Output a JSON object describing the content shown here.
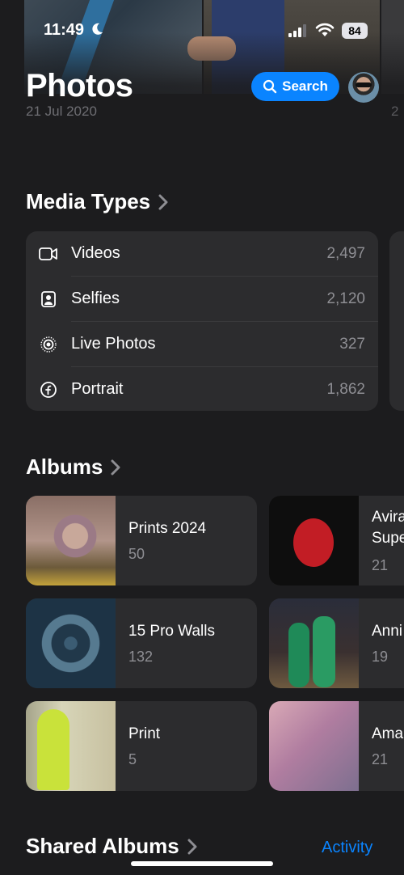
{
  "status_bar": {
    "time": "11:49",
    "battery": "84"
  },
  "header": {
    "title": "Photos",
    "date": "21 Jul 2020",
    "search_label": "Search"
  },
  "media_types": {
    "title": "Media Types",
    "items": [
      {
        "label": "Videos",
        "count": "2,497",
        "icon": "video-icon"
      },
      {
        "label": "Selfies",
        "count": "2,120",
        "icon": "selfie-icon"
      },
      {
        "label": "Live Photos",
        "count": "327",
        "icon": "live-photo-icon"
      },
      {
        "label": "Portrait",
        "count": "1,862",
        "icon": "portrait-icon"
      }
    ]
  },
  "albums": {
    "title": "Albums",
    "items": [
      {
        "name": "Prints 2024",
        "count": "50"
      },
      {
        "name": "Avira",
        "name2": "Supe",
        "count": "21"
      },
      {
        "name": "15 Pro Walls",
        "count": "132"
      },
      {
        "name": "Anni",
        "count": "19"
      },
      {
        "name": "Print",
        "count": "5"
      },
      {
        "name": "Ama",
        "count": "21"
      }
    ]
  },
  "shared_albums": {
    "title": "Shared Albums",
    "activity_label": "Activity"
  },
  "colors": {
    "accent": "#0a84ff",
    "background": "#1c1c1e",
    "card": "#2c2c2e",
    "secondary_text": "#8e8e93"
  }
}
